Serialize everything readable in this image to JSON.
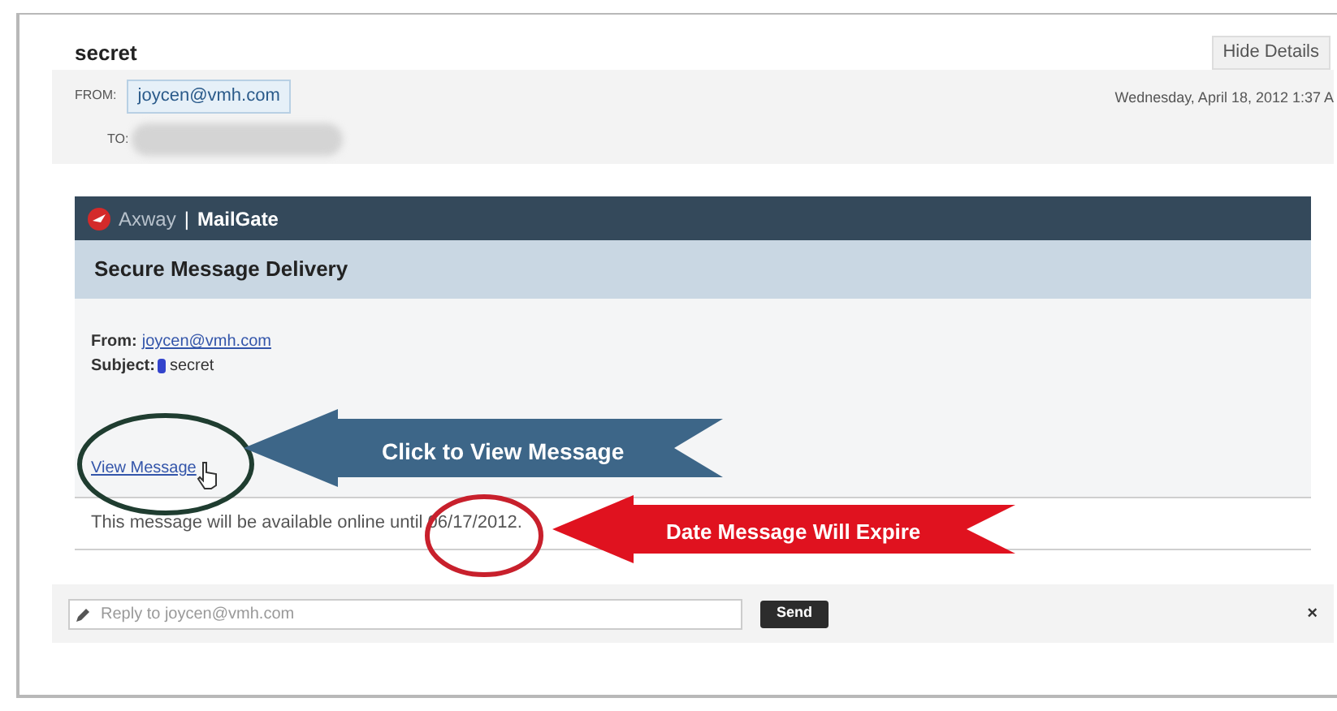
{
  "email": {
    "subject": "secret",
    "hide_details_button": "Hide Details",
    "from_label": "FROM:",
    "from": "joycen@vmh.com",
    "to_label": "TO:",
    "date": "Wednesday, April 18, 2012 1:37 A"
  },
  "mailgate": {
    "brand": "Axway",
    "separator": "|",
    "product": "MailGate",
    "heading": "Secure Message Delivery",
    "from_label": "From:",
    "from": "joycen@vmh.com",
    "subject_label": "Subject:",
    "subject": "secret",
    "view_link": "View Message",
    "expiry_text": "This message will be available online until 06/17/2012."
  },
  "reply": {
    "placeholder": "Reply to joycen@vmh.com",
    "send_button": "Send",
    "close": "×"
  },
  "annotations": [
    {
      "kind": "ellipse",
      "color": "#1f3d30"
    },
    {
      "kind": "arrow",
      "label": "Click to View Message",
      "color": "#3d6688"
    },
    {
      "kind": "ellipse",
      "color": "#c8202c"
    },
    {
      "kind": "arrow",
      "label": "Date Message Will Expire",
      "color": "#e0121f"
    }
  ]
}
